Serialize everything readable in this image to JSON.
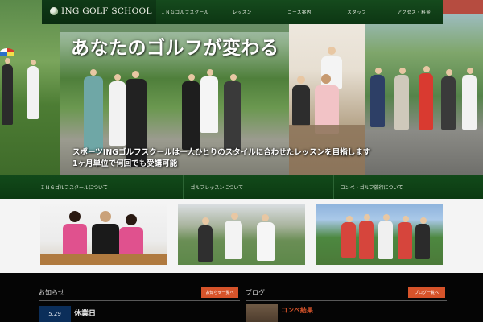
{
  "header": {
    "logo_text": "ING GOLF SCHOOL",
    "logo_icon": "golf-ball-icon",
    "nav": [
      "ＩＮＧゴルフスクール",
      "レッスン",
      "コース案内",
      "スタッフ",
      "アクセス・料金"
    ]
  },
  "hero": {
    "title": "あなたのゴルフが変わる",
    "subtitle_line1": "スポーツINGゴルフスクールは一人ひとりのスタイルに合わせたレッスンを目指します",
    "subtitle_line2": "1ヶ月単位で何回でも受講可能"
  },
  "band": {
    "items": [
      "ＩＮＧゴルフスクールについて",
      "ゴルフレッスンについて",
      "コンペ・ゴルフ旅行について"
    ]
  },
  "cards": [
    {
      "label": "",
      "icon": "staff-photo"
    },
    {
      "label": "",
      "icon": "lesson-photo"
    },
    {
      "label": "",
      "icon": "group-photo"
    }
  ],
  "sections": {
    "news": {
      "title": "お知らせ",
      "button": "お知らせ一覧へ"
    },
    "blog": {
      "title": "ブログ",
      "button": "ブログ一覧へ"
    }
  },
  "news_item": {
    "date": "5.29",
    "title": "休業日"
  },
  "blog_item": {
    "title": "コンペ結果"
  },
  "colors": {
    "header_green": "#0d3613",
    "band_green": "#0c3a12",
    "accent_orange": "#d6532a",
    "date_navy": "#0b2e5a",
    "bottom_black": "#050505"
  }
}
